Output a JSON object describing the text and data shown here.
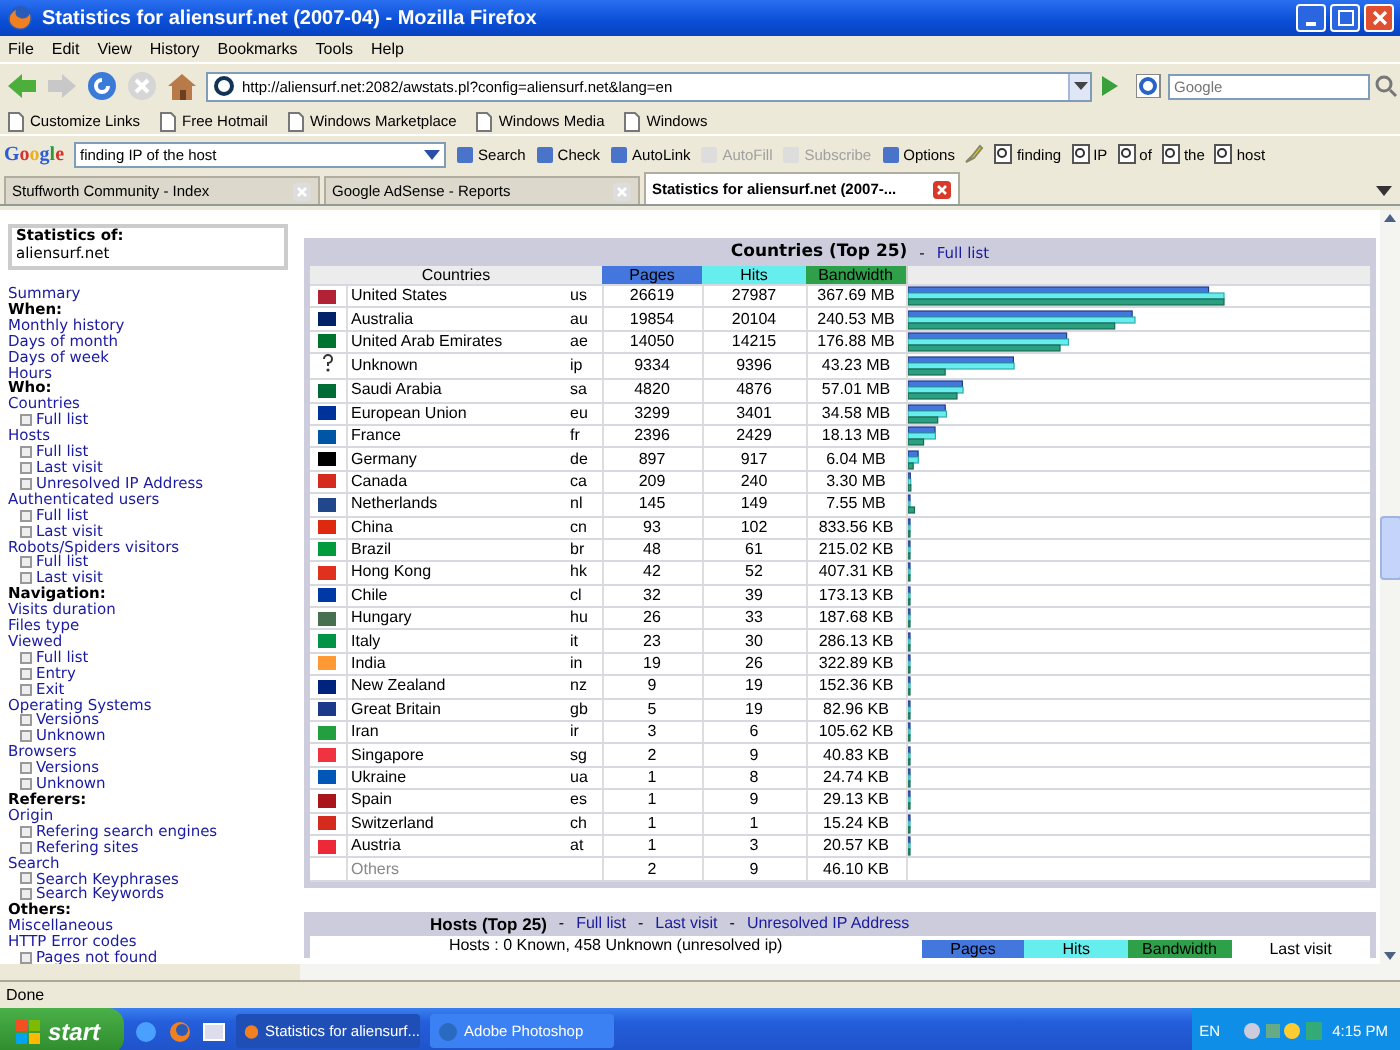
{
  "window": {
    "title": "Statistics for aliensurf.net (2007-04) - Mozilla Firefox"
  },
  "menu": [
    "File",
    "Edit",
    "View",
    "History",
    "Bookmarks",
    "Tools",
    "Help"
  ],
  "address_bar": {
    "url": "http://aliensurf.net:2082/awstats.pl?config=aliensurf.net&lang=en"
  },
  "search_box": {
    "placeholder": "Google"
  },
  "bookmarks": [
    "Customize Links",
    "Free Hotmail",
    "Windows Marketplace",
    "Windows Media",
    "Windows"
  ],
  "google_toolbar": {
    "logo": "Google",
    "search_value": "finding IP of the host",
    "buttons": [
      {
        "label": "Search",
        "disabled": false
      },
      {
        "label": "Check",
        "disabled": false
      },
      {
        "label": "AutoLink",
        "disabled": false
      },
      {
        "label": "AutoFill",
        "disabled": true
      },
      {
        "label": "Subscribe",
        "disabled": true
      },
      {
        "label": "Options",
        "disabled": false
      }
    ],
    "highlight_words": [
      "finding",
      "IP",
      "of",
      "the",
      "host"
    ]
  },
  "tabs": [
    {
      "label": "Stuffworth Community - Index",
      "selected": false
    },
    {
      "label": "Google AdSense - Reports",
      "selected": false
    },
    {
      "label": "Statistics for aliensurf.net (2007-...",
      "selected": true
    }
  ],
  "sidebar": {
    "header_label": "Statistics of:",
    "site": "aliensurf.net",
    "items": [
      {
        "label": "Summary",
        "kind": "link"
      },
      {
        "label": "When:",
        "kind": "heading"
      },
      {
        "label": "Monthly history",
        "kind": "link"
      },
      {
        "label": "Days of month",
        "kind": "link"
      },
      {
        "label": "Days of week",
        "kind": "link"
      },
      {
        "label": "Hours",
        "kind": "link"
      },
      {
        "label": "Who:",
        "kind": "heading"
      },
      {
        "label": "Countries",
        "kind": "link"
      },
      {
        "label": "Full list",
        "kind": "sublink"
      },
      {
        "label": "Hosts",
        "kind": "link"
      },
      {
        "label": "Full list",
        "kind": "sublink"
      },
      {
        "label": "Last visit",
        "kind": "sublink"
      },
      {
        "label": "Unresolved IP Address",
        "kind": "sublink"
      },
      {
        "label": "Authenticated users",
        "kind": "link"
      },
      {
        "label": "Full list",
        "kind": "sublink"
      },
      {
        "label": "Last visit",
        "kind": "sublink"
      },
      {
        "label": "Robots/Spiders visitors",
        "kind": "link"
      },
      {
        "label": "Full list",
        "kind": "sublink"
      },
      {
        "label": "Last visit",
        "kind": "sublink"
      },
      {
        "label": "Navigation:",
        "kind": "heading"
      },
      {
        "label": "Visits duration",
        "kind": "link"
      },
      {
        "label": "Files type",
        "kind": "link"
      },
      {
        "label": "Viewed",
        "kind": "link"
      },
      {
        "label": "Full list",
        "kind": "sublink"
      },
      {
        "label": "Entry",
        "kind": "sublink"
      },
      {
        "label": "Exit",
        "kind": "sublink"
      },
      {
        "label": "Operating Systems",
        "kind": "link"
      },
      {
        "label": "Versions",
        "kind": "sublink"
      },
      {
        "label": "Unknown",
        "kind": "sublink"
      },
      {
        "label": "Browsers",
        "kind": "link"
      },
      {
        "label": "Versions",
        "kind": "sublink"
      },
      {
        "label": "Unknown",
        "kind": "sublink"
      },
      {
        "label": "Referers:",
        "kind": "heading"
      },
      {
        "label": "Origin",
        "kind": "link"
      },
      {
        "label": "Refering search engines",
        "kind": "sublink"
      },
      {
        "label": "Refering sites",
        "kind": "sublink"
      },
      {
        "label": "Search",
        "kind": "link"
      },
      {
        "label": "Search Keyphrases",
        "kind": "sublink"
      },
      {
        "label": "Search Keywords",
        "kind": "sublink"
      },
      {
        "label": "Others:",
        "kind": "heading"
      },
      {
        "label": "Miscellaneous",
        "kind": "link"
      },
      {
        "label": "HTTP Error codes",
        "kind": "link"
      },
      {
        "label": "Pages not found",
        "kind": "sublink"
      }
    ]
  },
  "countries": {
    "title": "Countries (Top 25)",
    "separator": "-",
    "link": "Full list",
    "columns": [
      "Countries",
      "Pages",
      "Hits",
      "Bandwidth"
    ],
    "rows": [
      {
        "kind": "flag",
        "color": "#b22234",
        "name": "United States",
        "code": "us",
        "pages": "26619",
        "hits": "27987",
        "bandwidth": "367.69 MB"
      },
      {
        "kind": "flag",
        "color": "#012169",
        "name": "Australia",
        "code": "au",
        "pages": "19854",
        "hits": "20104",
        "bandwidth": "240.53 MB"
      },
      {
        "kind": "flag",
        "color": "#00732f",
        "name": "United Arab Emirates",
        "code": "ae",
        "pages": "14050",
        "hits": "14215",
        "bandwidth": "176.88 MB"
      },
      {
        "kind": "unknown",
        "name": "Unknown",
        "code": "ip",
        "pages": "9334",
        "hits": "9396",
        "bandwidth": "43.23 MB"
      },
      {
        "kind": "flag",
        "color": "#006c35",
        "name": "Saudi Arabia",
        "code": "sa",
        "pages": "4820",
        "hits": "4876",
        "bandwidth": "57.01 MB"
      },
      {
        "kind": "flag",
        "color": "#003399",
        "name": "European Union",
        "code": "eu",
        "pages": "3299",
        "hits": "3401",
        "bandwidth": "34.58 MB"
      },
      {
        "kind": "flag",
        "color": "#0055a4",
        "name": "France",
        "code": "fr",
        "pages": "2396",
        "hits": "2429",
        "bandwidth": "18.13 MB"
      },
      {
        "kind": "flag",
        "color": "#000000",
        "name": "Germany",
        "code": "de",
        "pages": "897",
        "hits": "917",
        "bandwidth": "6.04 MB"
      },
      {
        "kind": "flag",
        "color": "#d52b1e",
        "name": "Canada",
        "code": "ca",
        "pages": "209",
        "hits": "240",
        "bandwidth": "3.30 MB"
      },
      {
        "kind": "flag",
        "color": "#21468b",
        "name": "Netherlands",
        "code": "nl",
        "pages": "145",
        "hits": "149",
        "bandwidth": "7.55 MB"
      },
      {
        "kind": "flag",
        "color": "#de2910",
        "name": "China",
        "code": "cn",
        "pages": "93",
        "hits": "102",
        "bandwidth": "833.56 KB"
      },
      {
        "kind": "flag",
        "color": "#009c3b",
        "name": "Brazil",
        "code": "br",
        "pages": "48",
        "hits": "61",
        "bandwidth": "215.02 KB"
      },
      {
        "kind": "flag",
        "color": "#e0301e",
        "name": "Hong Kong",
        "code": "hk",
        "pages": "42",
        "hits": "52",
        "bandwidth": "407.31 KB"
      },
      {
        "kind": "flag",
        "color": "#0039a6",
        "name": "Chile",
        "code": "cl",
        "pages": "32",
        "hits": "39",
        "bandwidth": "173.13 KB"
      },
      {
        "kind": "flag",
        "color": "#477050",
        "name": "Hungary",
        "code": "hu",
        "pages": "26",
        "hits": "33",
        "bandwidth": "187.68 KB"
      },
      {
        "kind": "flag",
        "color": "#009246",
        "name": "Italy",
        "code": "it",
        "pages": "23",
        "hits": "30",
        "bandwidth": "286.13 KB"
      },
      {
        "kind": "flag",
        "color": "#ff9933",
        "name": "India",
        "code": "in",
        "pages": "19",
        "hits": "26",
        "bandwidth": "322.89 KB"
      },
      {
        "kind": "flag",
        "color": "#00247d",
        "name": "New Zealand",
        "code": "nz",
        "pages": "9",
        "hits": "19",
        "bandwidth": "152.36 KB"
      },
      {
        "kind": "flag",
        "color": "#1b3a8a",
        "name": "Great Britain",
        "code": "gb",
        "pages": "5",
        "hits": "19",
        "bandwidth": "82.96 KB"
      },
      {
        "kind": "flag",
        "color": "#239f40",
        "name": "Iran",
        "code": "ir",
        "pages": "3",
        "hits": "6",
        "bandwidth": "105.62 KB"
      },
      {
        "kind": "flag",
        "color": "#ef3340",
        "name": "Singapore",
        "code": "sg",
        "pages": "2",
        "hits": "9",
        "bandwidth": "40.83 KB"
      },
      {
        "kind": "flag",
        "color": "#0057b7",
        "name": "Ukraine",
        "code": "ua",
        "pages": "1",
        "hits": "8",
        "bandwidth": "24.74 KB"
      },
      {
        "kind": "flag",
        "color": "#aa151b",
        "name": "Spain",
        "code": "es",
        "pages": "1",
        "hits": "9",
        "bandwidth": "29.13 KB"
      },
      {
        "kind": "flag",
        "color": "#d52b1e",
        "name": "Switzerland",
        "code": "ch",
        "pages": "1",
        "hits": "1",
        "bandwidth": "15.24 KB"
      },
      {
        "kind": "flag",
        "color": "#ed2939",
        "name": "Austria",
        "code": "at",
        "pages": "1",
        "hits": "3",
        "bandwidth": "20.57 KB"
      }
    ],
    "others": {
      "name": "Others",
      "pages": "2",
      "hits": "9",
      "bandwidth": "46.10 KB"
    }
  },
  "hosts": {
    "title": "Hosts (Top 25)",
    "separator": "-",
    "links": [
      "Full list",
      "Last visit",
      "Unresolved IP Address"
    ],
    "summary": "Hosts : 0 Known, 458 Unknown (unresolved ip)",
    "columns": [
      "Pages",
      "Hits",
      "Bandwidth",
      "Last visit"
    ]
  },
  "status_bar": "Done",
  "taskbar": {
    "start": "start",
    "tasks": [
      {
        "label": "Statistics for aliensurf...",
        "selected": true
      },
      {
        "label": "Adobe Photoshop",
        "selected": false
      }
    ],
    "language": "EN",
    "time": "4:15 PM"
  }
}
